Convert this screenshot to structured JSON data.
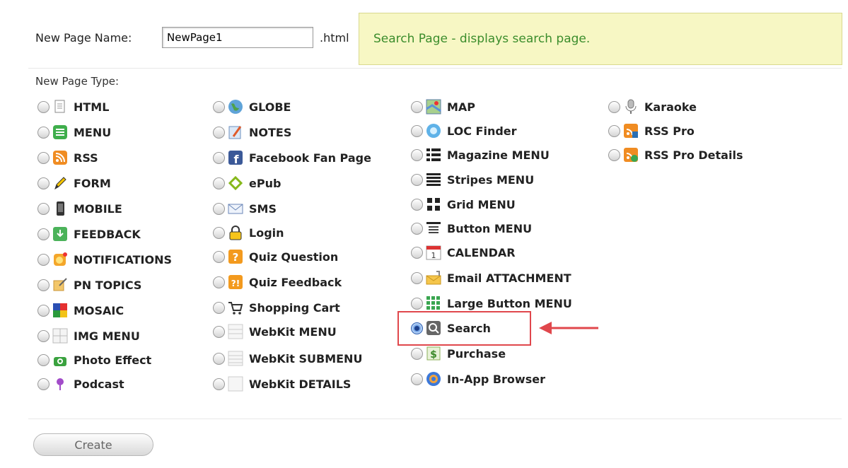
{
  "form": {
    "name_label": "New Page Name:",
    "name_value": "NewPage1",
    "extension": ".html",
    "description": "Search Page - displays search page.",
    "type_label": "New Page Type:",
    "create_label": "Create"
  },
  "page_types": {
    "col1": [
      {
        "label": "HTML",
        "icon": "document-icon",
        "checked": false
      },
      {
        "label": "MENU",
        "icon": "menu-list-icon",
        "checked": false
      },
      {
        "label": "RSS",
        "icon": "rss-icon",
        "checked": false
      },
      {
        "label": "FORM",
        "icon": "pencil-icon",
        "checked": false
      },
      {
        "label": "MOBILE",
        "icon": "phone-icon",
        "checked": false
      },
      {
        "label": "FEEDBACK",
        "icon": "feedback-icon",
        "checked": false
      },
      {
        "label": "NOTIFICATIONS",
        "icon": "notification-icon",
        "checked": false
      },
      {
        "label": "PN TOPICS",
        "icon": "topics-icon",
        "checked": false
      },
      {
        "label": "MOSAIC",
        "icon": "mosaic-icon",
        "checked": false
      },
      {
        "label": "IMG MENU",
        "icon": "image-grid-icon",
        "checked": false
      },
      {
        "label": "Photo Effect",
        "icon": "camera-icon",
        "checked": false
      },
      {
        "label": "Podcast",
        "icon": "podcast-icon",
        "checked": false
      }
    ],
    "col2": [
      {
        "label": "GLOBE",
        "icon": "globe-icon",
        "checked": false
      },
      {
        "label": "NOTES",
        "icon": "notes-icon",
        "checked": false
      },
      {
        "label": "Facebook Fan Page",
        "icon": "facebook-icon",
        "checked": false
      },
      {
        "label": "ePub",
        "icon": "epub-icon",
        "checked": false
      },
      {
        "label": "SMS",
        "icon": "envelope-icon",
        "checked": false
      },
      {
        "label": "Login",
        "icon": "lock-icon",
        "checked": false
      },
      {
        "label": "Quiz Question",
        "icon": "question-icon",
        "checked": false
      },
      {
        "label": "Quiz Feedback",
        "icon": "quiz-feedback-icon",
        "checked": false
      },
      {
        "label": "Shopping Cart",
        "icon": "cart-icon",
        "checked": false
      },
      {
        "label": "WebKit MENU",
        "icon": "webkit-menu-icon",
        "checked": false
      },
      {
        "label": "WebKit SUBMENU",
        "icon": "webkit-submenu-icon",
        "checked": false
      },
      {
        "label": "WebKit DETAILS",
        "icon": "webkit-details-icon",
        "checked": false
      }
    ],
    "col3": [
      {
        "label": "MAP",
        "icon": "map-icon",
        "checked": false
      },
      {
        "label": "LOC Finder",
        "icon": "location-icon",
        "checked": false
      },
      {
        "label": "Magazine MENU",
        "icon": "magazine-menu-icon",
        "checked": false
      },
      {
        "label": "Stripes MENU",
        "icon": "stripes-icon",
        "checked": false
      },
      {
        "label": "Grid MENU",
        "icon": "grid-icon",
        "checked": false
      },
      {
        "label": "Button MENU",
        "icon": "button-menu-icon",
        "checked": false
      },
      {
        "label": "CALENDAR",
        "icon": "calendar-icon",
        "checked": false
      },
      {
        "label": "Email ATTACHMENT",
        "icon": "email-attachment-icon",
        "checked": false
      },
      {
        "label": "Large Button MENU",
        "icon": "large-button-icon",
        "checked": false
      },
      {
        "label": "Search",
        "icon": "search-icon",
        "checked": true
      },
      {
        "label": "Purchase",
        "icon": "purchase-icon",
        "checked": false
      },
      {
        "label": "In-App Browser",
        "icon": "browser-icon",
        "checked": false
      }
    ],
    "col4": [
      {
        "label": "Karaoke",
        "icon": "microphone-icon",
        "checked": false
      },
      {
        "label": "RSS Pro",
        "icon": "rss-pro-icon",
        "checked": false
      },
      {
        "label": "RSS Pro Details",
        "icon": "rss-pro-details-icon",
        "checked": false
      }
    ]
  },
  "colors": {
    "description_text": "#3b8d2c",
    "description_bg": "#f7f7c4",
    "highlight": "#e0474c"
  }
}
